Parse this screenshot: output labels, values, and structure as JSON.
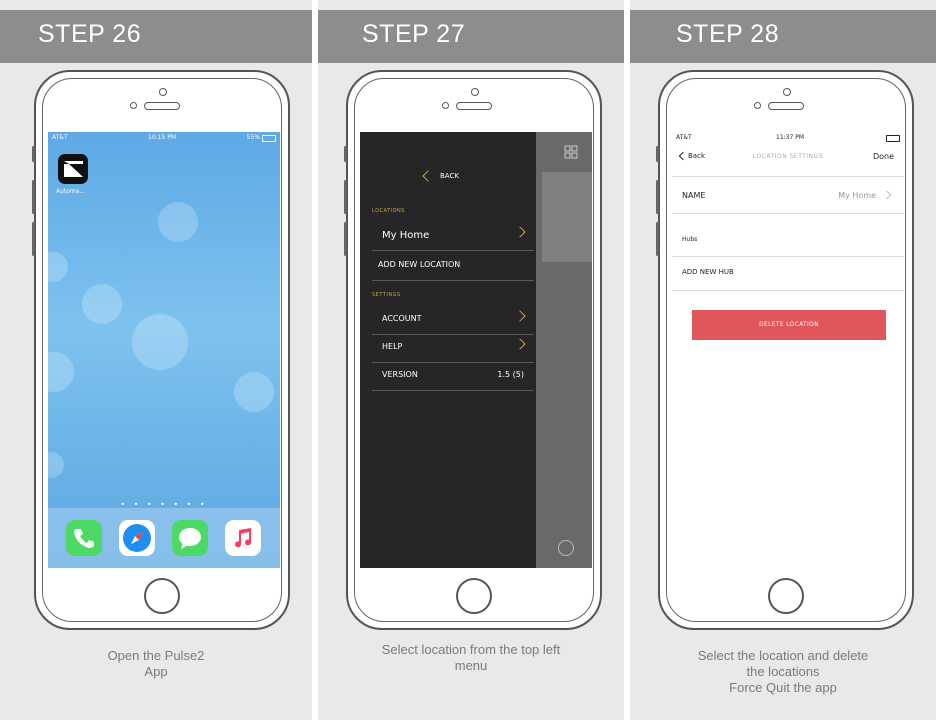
{
  "steps": [
    {
      "title": "STEP 26",
      "caption_line1": "Open the Pulse2",
      "caption_line2": "App",
      "caption_line3": ""
    },
    {
      "title": "STEP 27",
      "caption_line1": "Select location from the top left",
      "caption_line2": "menu",
      "caption_line3": ""
    },
    {
      "title": "STEP 28",
      "caption_line1": "Select the location and delete",
      "caption_line2": "the locations",
      "caption_line3": "Force Quit the app"
    }
  ],
  "screen1": {
    "carrier": "AT&T",
    "time": "10:15 PM",
    "battery": "55%",
    "app_label": "Automa...",
    "page_dots": "• • • • • • •",
    "dock_icons": [
      "phone-icon",
      "safari-icon",
      "messages-icon",
      "music-icon"
    ]
  },
  "screen2": {
    "back_label": "BACK",
    "locations_header": "LOCATIONS",
    "location_item": "My Home",
    "add_location": "ADD NEW LOCATION",
    "settings_header": "SETTINGS",
    "account": "ACCOUNT",
    "help": "HELP",
    "version_label": "VERSION",
    "version_value": "1.5 (5)"
  },
  "screen3": {
    "carrier": "AT&T",
    "time": "11:37 PM",
    "back": "Back",
    "title": "LOCATION SETTINGS",
    "done": "Done",
    "name_label": "NAME",
    "name_value": "My Home",
    "hubs_label": "Hubs",
    "add_hub": "ADD NEW HUB",
    "delete_label": "DELETE LOCATION"
  },
  "colors": {
    "step_bar": "#8d8d8f",
    "background": "#e9e9ea",
    "delete_button": "#e0565b",
    "accent_gold": "#c9a24a"
  }
}
